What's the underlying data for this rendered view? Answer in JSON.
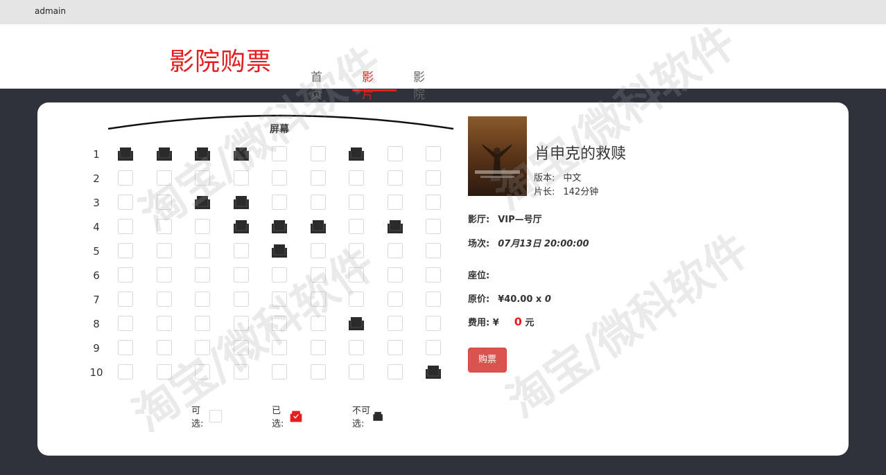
{
  "topbar": {
    "user": "admain"
  },
  "header": {
    "logo": "影院购票",
    "nav": [
      {
        "label": "首页",
        "active": false
      },
      {
        "label": "影片",
        "active": true
      },
      {
        "label": "影院",
        "active": false
      }
    ]
  },
  "screen": {
    "label": "屏幕"
  },
  "seat_map": {
    "rows": [
      "1",
      "2",
      "3",
      "4",
      "5",
      "6",
      "7",
      "8",
      "9",
      "10"
    ],
    "cols": 9,
    "unavailable": [
      [
        1,
        1
      ],
      [
        1,
        2
      ],
      [
        1,
        3
      ],
      [
        1,
        4
      ],
      [
        1,
        7
      ],
      [
        3,
        3
      ],
      [
        3,
        4
      ],
      [
        4,
        4
      ],
      [
        4,
        5
      ],
      [
        4,
        6
      ],
      [
        4,
        8
      ],
      [
        5,
        5
      ],
      [
        8,
        7
      ],
      [
        10,
        9
      ]
    ],
    "selected": []
  },
  "legend": {
    "available": "可选:",
    "selected": "已选:",
    "unavailable": "不可选:"
  },
  "movie": {
    "title": "肖申克的救赎",
    "version_label": "版本:",
    "version": "中文",
    "length_label": "片长:",
    "length": "142分钟"
  },
  "order": {
    "hall_label": "影厅:",
    "hall": "VIP—号厅",
    "session_label": "场次:",
    "session": "07月13日 20:00:00",
    "seat_label": "座位:",
    "price_label": "原价:",
    "price": "¥40.00 x",
    "count": "0",
    "fee_label": "费用: ¥",
    "fee": "0",
    "fee_unit": "元",
    "buy_label": "购票"
  },
  "watermark": "淘宝/微科软件",
  "colors": {
    "accent": "#e41e1e",
    "background": "#2f323a",
    "buy_button": "#d9534f"
  }
}
